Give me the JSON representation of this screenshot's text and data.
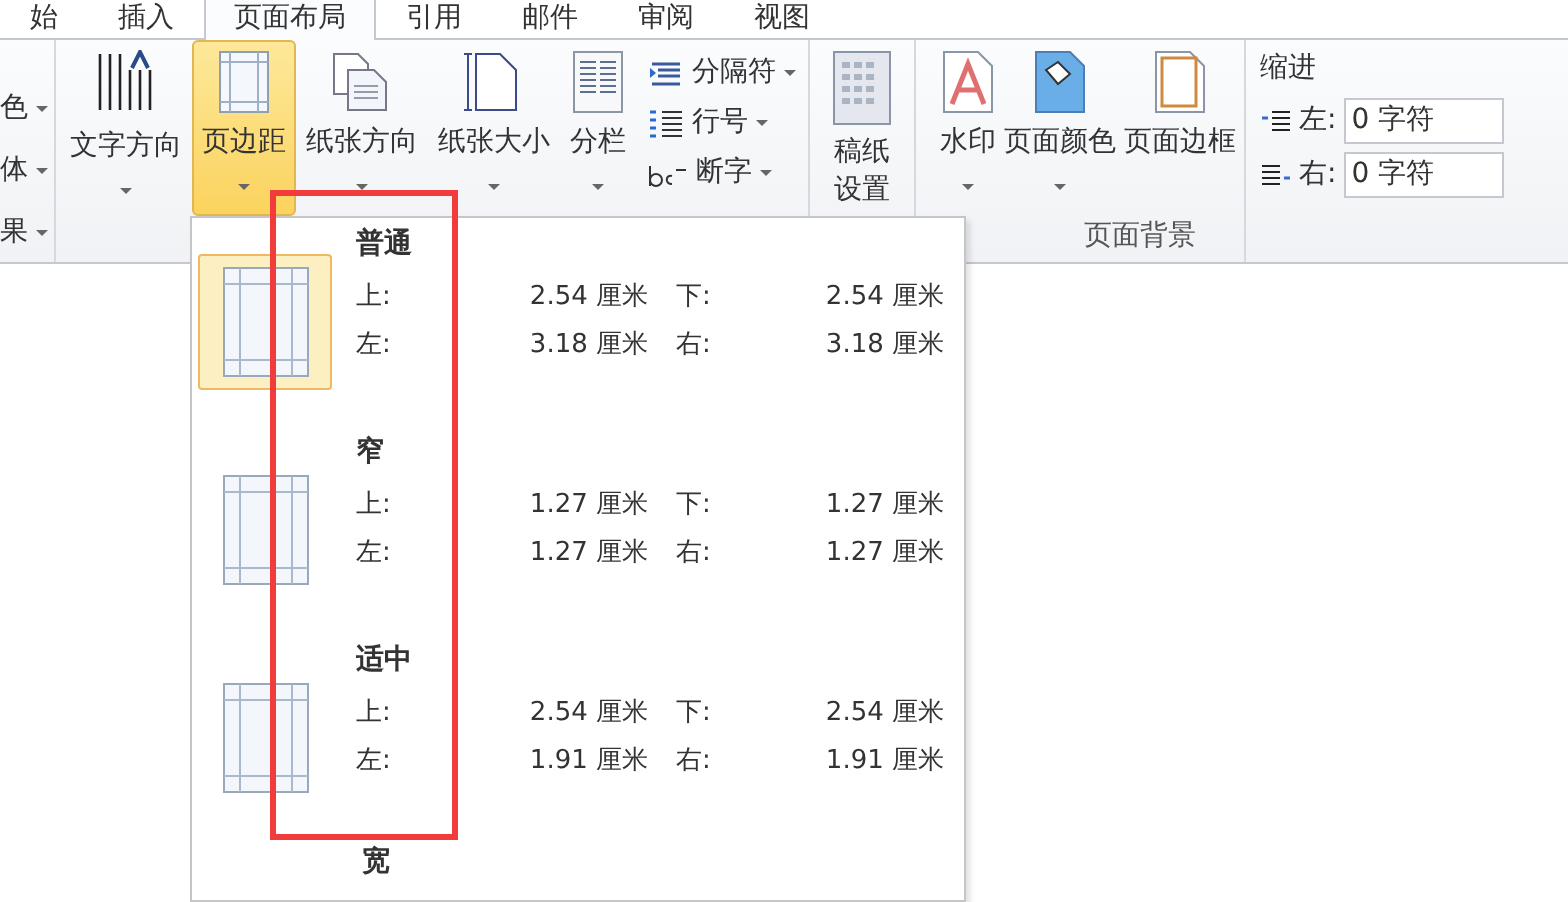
{
  "tabs": [
    {
      "label": "始",
      "selected": false
    },
    {
      "label": "插入",
      "selected": false
    },
    {
      "label": "页面布局",
      "selected": true
    },
    {
      "label": "引用",
      "selected": false
    },
    {
      "label": "邮件",
      "selected": false
    },
    {
      "label": "审阅",
      "selected": false
    },
    {
      "label": "视图",
      "selected": false
    }
  ],
  "theme_group": {
    "items": [
      "色",
      "体",
      "果"
    ]
  },
  "page_setup": {
    "buttons": [
      {
        "kind": "text-direction",
        "label": "文字方向",
        "selected": false
      },
      {
        "kind": "margins",
        "label": "页边距",
        "selected": true
      },
      {
        "kind": "orientation",
        "label": "纸张方向",
        "selected": false
      },
      {
        "kind": "size",
        "label": "纸张大小",
        "selected": false
      },
      {
        "kind": "columns",
        "label": "分栏",
        "selected": false
      }
    ],
    "small_buttons": [
      {
        "kind": "breaks",
        "label": "分隔符"
      },
      {
        "kind": "line-numbers",
        "label": "行号"
      },
      {
        "kind": "hyphenation",
        "label": "断字"
      }
    ]
  },
  "manuscript": {
    "lines": [
      "稿纸",
      "设置"
    ]
  },
  "page_background": {
    "label": "页面背景",
    "buttons": [
      {
        "kind": "watermark",
        "label": "水印"
      },
      {
        "kind": "page-color",
        "label": "页面颜色"
      },
      {
        "kind": "page-border",
        "label": "页面边框"
      }
    ]
  },
  "indent": {
    "title": "缩进",
    "fields": [
      {
        "kind": "left",
        "label": "左:",
        "value": "0 字符"
      },
      {
        "kind": "right",
        "label": "右:",
        "value": "0 字符"
      }
    ]
  },
  "margins_menu": {
    "items": [
      {
        "name": "普通",
        "selected": true,
        "top_label": "上:",
        "top": "2.54 厘米",
        "bottom_label": "下:",
        "bottom": "2.54 厘米",
        "left_label": "左:",
        "left": "3.18 厘米",
        "right_label": "右:",
        "right": "3.18 厘米"
      },
      {
        "name": "窄",
        "selected": false,
        "top_label": "上:",
        "top": "1.27 厘米",
        "bottom_label": "下:",
        "bottom": "1.27 厘米",
        "left_label": "左:",
        "left": "1.27 厘米",
        "right_label": "右:",
        "right": "1.27 厘米"
      },
      {
        "name": "适中",
        "selected": false,
        "top_label": "上:",
        "top": "2.54 厘米",
        "bottom_label": "下:",
        "bottom": "2.54 厘米",
        "left_label": "左:",
        "left": "1.91 厘米",
        "right_label": "右:",
        "right": "1.91 厘米"
      }
    ],
    "partial_item": "宽"
  }
}
